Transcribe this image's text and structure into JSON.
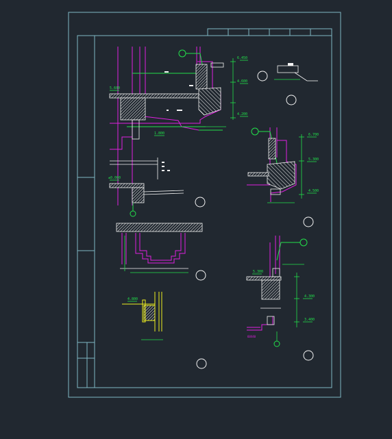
{
  "colors": {
    "background": "#212830",
    "frame": "#7fb7c4",
    "magenta": "#e020e0",
    "green": "#22e04a",
    "white": "#f4f4f4",
    "yellow": "#f0f020",
    "dim": "#8a8a8a"
  },
  "labels": {
    "d1_el_top": "6.450",
    "d1_el_mid": "4.600",
    "d1_el_low": "4.200",
    "d1_el_slab": "5.600",
    "d1_el_sill": "1.800",
    "d1_el_base": "±0.000",
    "d2_el_top": "6.700",
    "d2_el_mid": "5.300",
    "d2_el_low": "4.500",
    "d6_el_slab": "5.300",
    "d6_el_mid": "4.300",
    "d6_el_low": "3.400",
    "d5_el": "4.800",
    "d6_note": "60X40"
  }
}
